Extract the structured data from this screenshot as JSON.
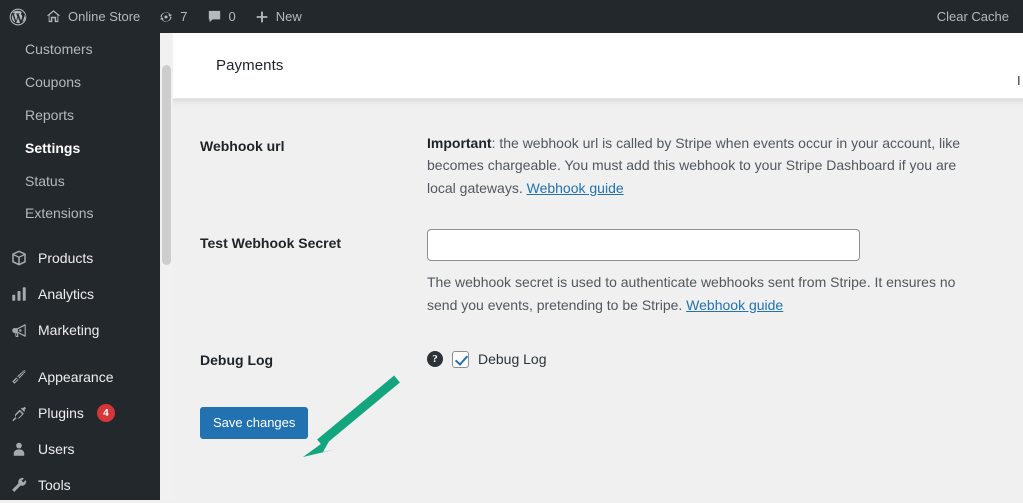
{
  "adminbar": {
    "logo_icon": "wordpress-logo-icon",
    "site_name": "Online Store",
    "site_icon": "home-icon",
    "updates_icon": "updates-icon",
    "updates_count": "7",
    "comments_icon": "comment-bubble-icon",
    "comments_count": "0",
    "new_icon": "plus-icon",
    "new_label": "New",
    "clear_cache_label": "Clear Cache"
  },
  "sidebar": {
    "submenu": [
      {
        "label": "Customers",
        "current": false
      },
      {
        "label": "Coupons",
        "current": false
      },
      {
        "label": "Reports",
        "current": false
      },
      {
        "label": "Settings",
        "current": true
      },
      {
        "label": "Status",
        "current": false
      },
      {
        "label": "Extensions",
        "current": false
      }
    ],
    "menu": [
      {
        "label": "Products",
        "icon": "products-box-icon",
        "badge": ""
      },
      {
        "label": "Analytics",
        "icon": "analytics-bars-icon",
        "badge": ""
      },
      {
        "label": "Marketing",
        "icon": "marketing-megaphone-icon",
        "badge": ""
      },
      {
        "label": "Appearance",
        "icon": "appearance-brush-icon",
        "badge": ""
      },
      {
        "label": "Plugins",
        "icon": "plugins-plug-icon",
        "badge": "4"
      },
      {
        "label": "Users",
        "icon": "users-person-icon",
        "badge": ""
      },
      {
        "label": "Tools",
        "icon": "tools-wrench-icon",
        "badge": ""
      }
    ]
  },
  "page": {
    "title": "Payments",
    "header_right_clipped": "I"
  },
  "settings": {
    "webhook_url": {
      "label": "Webhook url",
      "desc_strong": "Important",
      "desc_line1": ": the webhook url is called by Stripe when events occur in your account, like",
      "desc_line2": "becomes chargeable. You must add this webhook to your Stripe Dashboard if you are",
      "desc_line3_pre": "local gateways. ",
      "desc_link": "Webhook guide"
    },
    "test_webhook_secret": {
      "label": "Test Webhook Secret",
      "value": "",
      "placeholder": "",
      "desc_line1": "The webhook secret is used to authenticate webhooks sent from Stripe. It ensures no",
      "desc_line2_pre": "send you events, pretending to be Stripe. ",
      "desc_link": "Webhook guide"
    },
    "debug_log": {
      "label": "Debug Log",
      "help_icon": "help-question-icon",
      "checkbox_label": "Debug Log",
      "checked": true
    },
    "save_button_label": "Save changes"
  },
  "annotation": {
    "arrow_color": "#13a57e",
    "arrow_name": "green-arrow-pointing-to-save-changes"
  },
  "colors": {
    "admin_bg": "#23282d",
    "accent_blue": "#2271b1",
    "badge_red": "#d63638",
    "page_bg": "#f0f0f1"
  }
}
